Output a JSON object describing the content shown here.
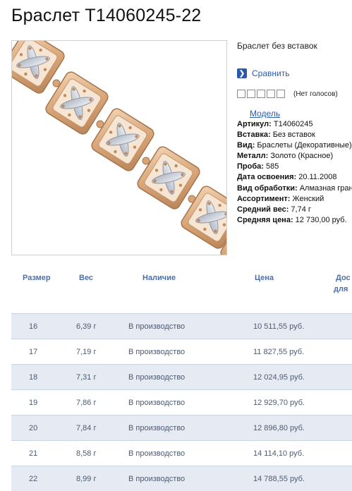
{
  "page": {
    "title": "Браслет Т14060245-22"
  },
  "product": {
    "description": "Браслет без вставок",
    "compare_label": "Сравнить",
    "rating": {
      "stars": 5,
      "filled": 0,
      "votes_text": "(Нет голосов)"
    },
    "model_link": "Модель",
    "specs": [
      {
        "label": "Артикул:",
        "value": "Т14060245"
      },
      {
        "label": "Вставка:",
        "value": "Без вставок"
      },
      {
        "label": "Вид:",
        "value": "Браслеты (Декоративные)"
      },
      {
        "label": "Металл:",
        "value": "Золото (Красное)"
      },
      {
        "label": "Проба:",
        "value": "585"
      },
      {
        "label": "Дата освоения:",
        "value": "20.11.2008"
      },
      {
        "label": "Вид обработки:",
        "value": "Алмазная грань"
      },
      {
        "label": "Ассортимент:",
        "value": "Женский"
      },
      {
        "label": "Средний вес:",
        "value": "7,74 г"
      },
      {
        "label": "Средняя цена:",
        "value": "12 730,00 руб."
      }
    ]
  },
  "table": {
    "headers": {
      "size": "Размер",
      "weight": "Вес",
      "availability": "Наличие",
      "price": "Цена",
      "extra_1": "Дос",
      "extra_2": "для"
    },
    "rows": [
      {
        "size": "16",
        "weight": "6,39 г",
        "availability": "В производство",
        "price": "10 511,55 руб."
      },
      {
        "size": "17",
        "weight": "7,19 г",
        "availability": "В производство",
        "price": "11 827,55 руб."
      },
      {
        "size": "18",
        "weight": "7,31 г",
        "availability": "В производство",
        "price": "12 024,95 руб."
      },
      {
        "size": "19",
        "weight": "7,86 г",
        "availability": "В производство",
        "price": "12 929,70 руб."
      },
      {
        "size": "20",
        "weight": "7,84 г",
        "availability": "В производство",
        "price": "12 896,80 руб."
      },
      {
        "size": "21",
        "weight": "8,58 г",
        "availability": "В производство",
        "price": "14 114,10 руб."
      },
      {
        "size": "22",
        "weight": "8,99 г",
        "availability": "В производство",
        "price": "14 788,55 руб."
      }
    ]
  },
  "colors": {
    "link": "#2a5cb0",
    "header_text": "#4d6fa8",
    "row_alt": "#e6ebf3",
    "gold": "#d9a679",
    "silver": "#c9cfd8"
  }
}
